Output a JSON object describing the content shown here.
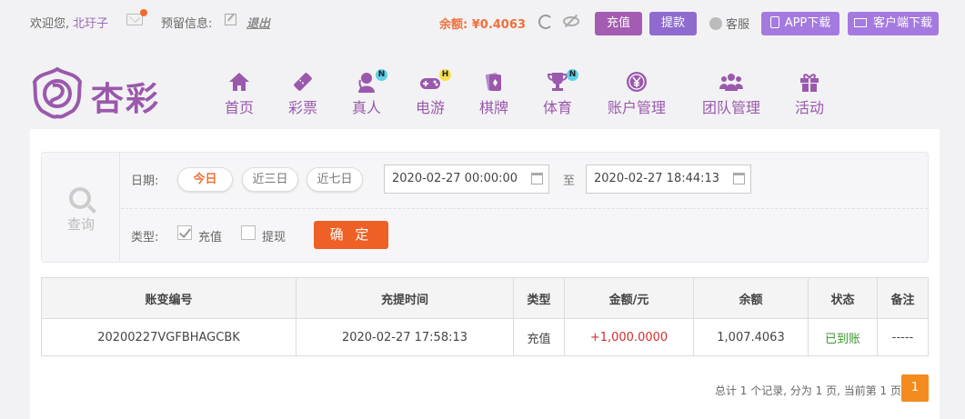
{
  "topbar": {
    "welcome": "欢迎您,",
    "username": "北玗子",
    "notice_label": "预留信息:",
    "logout": "退出",
    "balance": "余额: ¥0.4063",
    "recharge": "充值",
    "withdraw": "提款",
    "customer_service": "客服",
    "app_download": "APP下载",
    "client_download": "客户端下载"
  },
  "brand": {
    "logo_text": "杏彩"
  },
  "nav": [
    {
      "label": "首页",
      "icon": "home-icon"
    },
    {
      "label": "彩票",
      "icon": "ticket-icon"
    },
    {
      "label": "真人",
      "icon": "dealer-icon",
      "badge": "N"
    },
    {
      "label": "电游",
      "icon": "gamepad-icon",
      "badge": "H"
    },
    {
      "label": "棋牌",
      "icon": "cards-icon"
    },
    {
      "label": "体育",
      "icon": "trophy-icon",
      "badge": "N"
    },
    {
      "label": "账户管理",
      "icon": "yen-coin-icon"
    },
    {
      "label": "团队管理",
      "icon": "team-icon"
    },
    {
      "label": "活动",
      "icon": "gift-icon"
    }
  ],
  "filter": {
    "query_label": "查询",
    "date_label": "日期:",
    "quick_ranges": [
      "今日",
      "近三日",
      "近七日"
    ],
    "active_range": "今日",
    "start_date": "2020-02-27 00:00:00",
    "to_label": "至",
    "end_date": "2020-02-27 18:44:13",
    "type_label": "类型:",
    "type_options": [
      {
        "label": "充值",
        "checked": true
      },
      {
        "label": "提现",
        "checked": false
      }
    ],
    "confirm": "确 定"
  },
  "table": {
    "columns": [
      "账变编号",
      "充提时间",
      "类型",
      "金额/元",
      "余额",
      "状态",
      "备注"
    ],
    "rows": [
      [
        "20200227VGFBHAGCBK",
        "2020-02-27 17:58:13",
        "充值",
        "+1,000.0000",
        "1,007.4063",
        "已到账",
        "-----"
      ]
    ]
  },
  "pagination": {
    "summary": "总计 1 个记录, 分为 1 页, 当前第 1 页",
    "current_page": "1"
  },
  "colors": {
    "brand_purple": "#9a59ac",
    "accent_orange": "#ee6025",
    "amount_red": "#d22f2f",
    "status_green": "#3a9a2c"
  }
}
